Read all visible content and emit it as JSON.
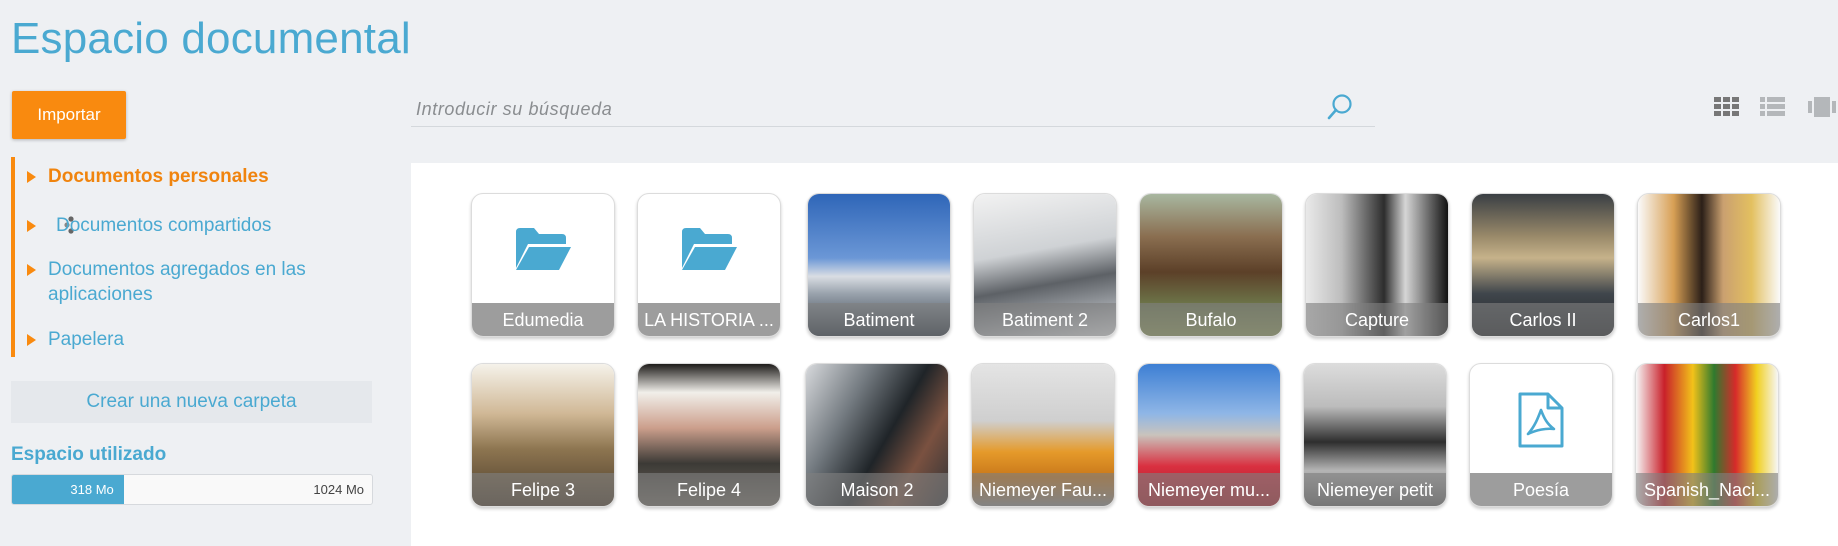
{
  "header": {
    "title": "Espacio documental"
  },
  "toolbar": {
    "import_label": "Importar",
    "search_placeholder": "Introducir su búsqueda",
    "views": [
      "grid-view-icon",
      "list-view-icon",
      "carousel-view-icon"
    ]
  },
  "sidebar": {
    "items": [
      {
        "label": "Documentos personales",
        "active": true
      },
      {
        "label": "Documentos compartidos",
        "icon": "share-icon"
      },
      {
        "label": "Documentos agregados en las",
        "label2": "aplicaciones"
      },
      {
        "label": "Papelera"
      }
    ],
    "new_folder_label": "Crear una nueva carpeta",
    "storage": {
      "title": "Espacio utilizado",
      "used_label": "318 Mo",
      "total_label": "1024 Mo",
      "used_fraction": 0.3105
    }
  },
  "documents": [
    {
      "name": "Edumedia",
      "kind": "folder",
      "icon": "folder-icon"
    },
    {
      "name": "LA HISTORIA ...",
      "kind": "folder",
      "icon": "folder-icon"
    },
    {
      "name": "Batiment",
      "kind": "image"
    },
    {
      "name": "Batiment 2",
      "kind": "image"
    },
    {
      "name": "Bufalo",
      "kind": "image"
    },
    {
      "name": "Capture",
      "kind": "image"
    },
    {
      "name": "Carlos II",
      "kind": "image"
    },
    {
      "name": "Carlos1",
      "kind": "image"
    },
    {
      "name": "Felipe 3",
      "kind": "image"
    },
    {
      "name": "Felipe 4",
      "kind": "image"
    },
    {
      "name": "Maison 2",
      "kind": "image"
    },
    {
      "name": "Niemeyer Fau...",
      "kind": "image"
    },
    {
      "name": "Niemeyer mu...",
      "kind": "image"
    },
    {
      "name": "Niemeyer petit",
      "kind": "image"
    },
    {
      "name": "Poesía",
      "kind": "pdf",
      "icon": "pdf-icon"
    },
    {
      "name": "Spanish_Naci...",
      "kind": "image"
    }
  ],
  "colors": {
    "accent": "#4aa9d1",
    "orange": "#f98a0f"
  }
}
